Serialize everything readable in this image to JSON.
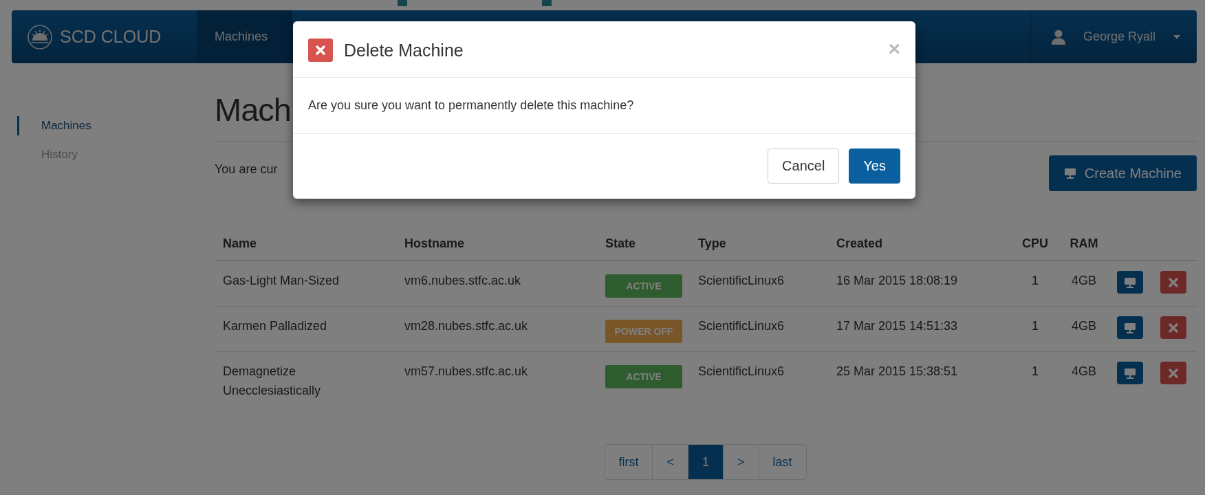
{
  "navbar": {
    "brand": "SCD CLOUD",
    "items": [
      {
        "label": "Machines",
        "selected": true
      }
    ],
    "user": "George Ryall"
  },
  "sidebar": {
    "items": [
      {
        "label": "Machines",
        "selected": true
      },
      {
        "label": "History",
        "selected": false
      }
    ]
  },
  "main": {
    "heading": "Mach",
    "intro": "You are cur",
    "create_button": "Create Machine"
  },
  "table": {
    "columns": [
      "Name",
      "Hostname",
      "State",
      "Type",
      "Created",
      "CPU",
      "RAM"
    ],
    "rows": [
      {
        "name": "Gas-Light Man-Sized",
        "hostname": "vm6.nubes.stfc.ac.uk",
        "state": {
          "label": "ACTIVE",
          "kind": "active"
        },
        "type": "ScientificLinux6",
        "created": "16 Mar 2015 18:08:19",
        "cpu": "1",
        "ram": "4GB"
      },
      {
        "name": "Karmen Palladized",
        "hostname": "vm28.nubes.stfc.ac.uk",
        "state": {
          "label": "POWER OFF",
          "kind": "power_off"
        },
        "type": "ScientificLinux6",
        "created": "17 Mar 2015 14:51:33",
        "cpu": "1",
        "ram": "4GB"
      },
      {
        "name": "Demagnetize Unecclesiastically",
        "hostname": "vm57.nubes.stfc.ac.uk",
        "state": {
          "label": "ACTIVE",
          "kind": "active"
        },
        "type": "ScientificLinux6",
        "created": "25 Mar 2015 15:38:51",
        "cpu": "1",
        "ram": "4GB"
      }
    ]
  },
  "pagination": [
    {
      "label": "first",
      "selected": false
    },
    {
      "label": "<",
      "selected": false
    },
    {
      "label": "1",
      "selected": true
    },
    {
      "label": ">",
      "selected": false
    },
    {
      "label": "last",
      "selected": false
    }
  ],
  "modal": {
    "title": "Delete Machine",
    "close": "×",
    "message": "Are you sure you want to permanently delete this machine?",
    "buttons": [
      {
        "label": "Cancel",
        "kind": "default"
      },
      {
        "label": "Yes",
        "kind": "primary"
      }
    ]
  }
}
